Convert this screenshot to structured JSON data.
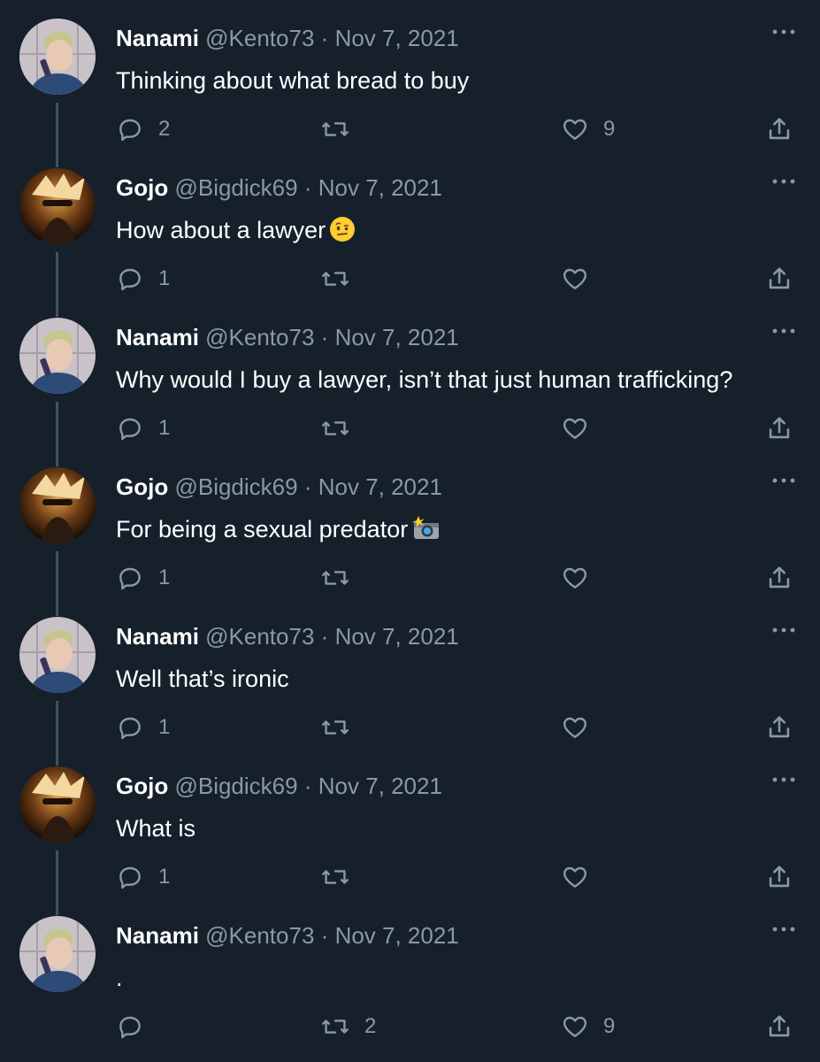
{
  "colors": {
    "background": "#15202b",
    "text_primary": "#ffffff",
    "text_secondary": "#8b98a5",
    "thread_line": "#3d5466"
  },
  "icons": {
    "reply": "reply-icon",
    "retweet": "retweet-icon",
    "like": "like-icon",
    "share": "share-icon",
    "more": "more-icon"
  },
  "tweets": [
    {
      "name": "Nanami",
      "handle": "@Kento73",
      "separator": "·",
      "date": "Nov 7, 2021",
      "text": "Thinking about what bread to buy",
      "emoji": "",
      "replies": "2",
      "retweets": "",
      "likes": "9"
    },
    {
      "name": "Gojo",
      "handle": "@Bigdick69",
      "separator": "·",
      "date": "Nov 7, 2021",
      "text": "How about a lawyer",
      "emoji": "raised-eyebrow-emoji",
      "replies": "1",
      "retweets": "",
      "likes": ""
    },
    {
      "name": "Nanami",
      "handle": "@Kento73",
      "separator": "·",
      "date": "Nov 7, 2021",
      "text": "Why would I buy a lawyer, isn’t that just human trafficking?",
      "emoji": "",
      "replies": "1",
      "retweets": "",
      "likes": ""
    },
    {
      "name": "Gojo",
      "handle": "@Bigdick69",
      "separator": "·",
      "date": "Nov 7, 2021",
      "text": "For being a sexual predator",
      "emoji": "camera-flash-emoji",
      "replies": "1",
      "retweets": "",
      "likes": ""
    },
    {
      "name": "Nanami",
      "handle": "@Kento73",
      "separator": "·",
      "date": "Nov 7, 2021",
      "text": "Well that’s ironic",
      "emoji": "",
      "replies": "1",
      "retweets": "",
      "likes": ""
    },
    {
      "name": "Gojo",
      "handle": "@Bigdick69",
      "separator": "·",
      "date": "Nov 7, 2021",
      "text": "What is",
      "emoji": "",
      "replies": "1",
      "retweets": "",
      "likes": ""
    },
    {
      "name": "Nanami",
      "handle": "@Kento73",
      "separator": "·",
      "date": "Nov 7, 2021",
      "text": ".",
      "emoji": "",
      "replies": "",
      "retweets": "2",
      "likes": "9"
    }
  ]
}
